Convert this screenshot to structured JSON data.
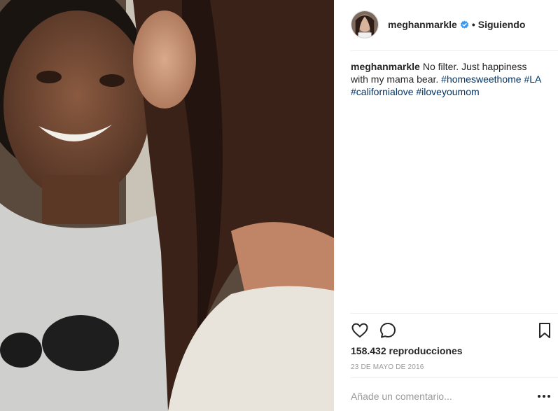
{
  "post": {
    "username": "meghanmarkle",
    "follow_status": "Siguiendo",
    "separator": "•",
    "caption": {
      "username": "meghanmarkle",
      "text": "No filter. Just happiness with my mama bear.",
      "hashtags": [
        "#homesweethome",
        "#LA",
        "#californialove",
        "#iloveyoumom"
      ]
    },
    "views": "158.432 reproducciones",
    "date": "23 DE MAYO DE 2016",
    "comment_placeholder": "Añade un comentario..."
  },
  "icons": {
    "like": "heart-icon",
    "comment": "comment-icon",
    "save": "bookmark-icon",
    "verified": "verified-badge-icon",
    "more": "more-options-icon"
  },
  "colors": {
    "hashtag": "#003569",
    "verified": "#3897f0",
    "text": "#262626",
    "muted": "#999999",
    "divider": "#efefef"
  }
}
